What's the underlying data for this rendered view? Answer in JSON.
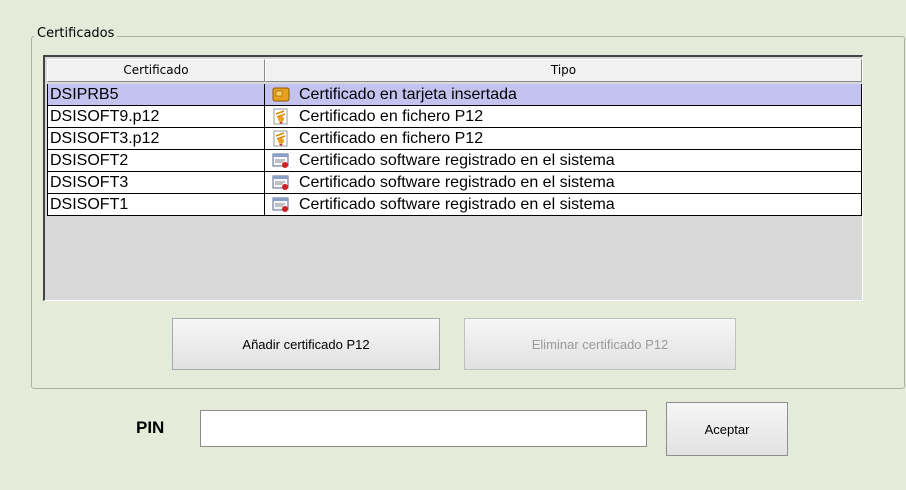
{
  "group": {
    "title": "Certificados"
  },
  "table": {
    "columns": [
      "Certificado",
      "Tipo"
    ],
    "rows": [
      {
        "name": "DSIPRB5",
        "type": "Certificado en tarjeta insertada",
        "icon": "smartcard-icon",
        "selected": true
      },
      {
        "name": "DSISOFT9.p12",
        "type": "Certificado en fichero P12",
        "icon": "certificate-file-icon",
        "selected": false
      },
      {
        "name": "DSISOFT3.p12",
        "type": "Certificado en fichero P12",
        "icon": "certificate-file-icon",
        "selected": false
      },
      {
        "name": "DSISOFT2",
        "type": "Certificado software registrado en el sistema",
        "icon": "system-certificate-icon",
        "selected": false
      },
      {
        "name": "DSISOFT3",
        "type": "Certificado software registrado en el sistema",
        "icon": "system-certificate-icon",
        "selected": false
      },
      {
        "name": "DSISOFT1",
        "type": "Certificado software registrado en el sistema",
        "icon": "system-certificate-icon",
        "selected": false
      }
    ]
  },
  "buttons": {
    "add_label": "Añadir certificado P12",
    "delete_label": "Eliminar certificado P12",
    "delete_enabled": false,
    "accept_label": "Aceptar"
  },
  "pin": {
    "label": "PIN",
    "value": ""
  },
  "colors": {
    "background": "#e4ebd9",
    "selected_row": "#c4c2ef"
  }
}
